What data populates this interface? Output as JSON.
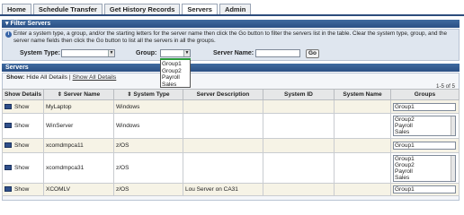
{
  "tabs": [
    "Home",
    "Schedule Transfer",
    "Get History Records",
    "Servers",
    "Admin"
  ],
  "active_tab": "Servers",
  "filter": {
    "header": "Filter Servers",
    "info": "Enter a system type, a group, and/or the starting letters for the server name then click the Go button to filter the servers list in the table. Clear the system type, group, and the server name fields then click the Go button to list all the servers in all the groups.",
    "system_type_label": "System Type:",
    "group_label": "Group:",
    "server_name_label": "Server Name:",
    "go_label": "Go",
    "group_options": [
      "Group1",
      "Group2",
      "Payroll",
      "Sales"
    ]
  },
  "servers": {
    "header": "Servers",
    "show_label": "Show:",
    "hide_all": "Hide All Details",
    "show_all": "Show All Details",
    "separator": "|",
    "page_count": "1-5 of 5",
    "columns": [
      "Show Details",
      "Server Name",
      "System Type",
      "Server Description",
      "System ID",
      "System Name",
      "Groups"
    ],
    "show_btn": "Show",
    "rows": [
      {
        "name": "MyLaptop",
        "type": "Windows",
        "desc": "",
        "groups": [
          "Group1"
        ]
      },
      {
        "name": "WinServer",
        "type": "Windows",
        "desc": "",
        "groups": [
          "Group2",
          "Payroll",
          "Sales"
        ]
      },
      {
        "name": "xcomdmpca11",
        "type": "z/OS",
        "desc": "",
        "groups": [
          "Group1"
        ]
      },
      {
        "name": "xcomdmpca31",
        "type": "z/OS",
        "desc": "",
        "groups": [
          "Group1",
          "Group2",
          "Payroll",
          "Sales"
        ]
      },
      {
        "name": "XCOMLV",
        "type": "z/OS",
        "desc": "Lou Server on CA31",
        "groups": [
          "Group1"
        ]
      }
    ]
  }
}
